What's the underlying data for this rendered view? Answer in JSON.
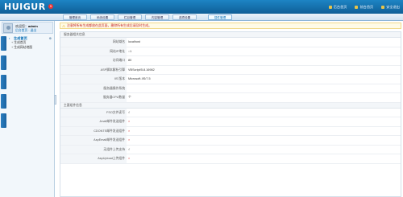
{
  "header": {
    "logo": "HUIGUR",
    "logo_badge": "5",
    "links": [
      {
        "label": "后台首页",
        "icon": "home-icon"
      },
      {
        "label": "前台首页",
        "icon": "globe-icon"
      },
      {
        "label": "安全退出",
        "icon": "logout-icon"
      }
    ]
  },
  "nav": {
    "tabs": [
      {
        "label": "管理首页"
      },
      {
        "label": "系统设置"
      },
      {
        "label": "栏目管理"
      },
      {
        "label": "内容管理"
      },
      {
        "label": "选项设置"
      },
      {
        "label": "插件管理"
      }
    ],
    "active_index": 5
  },
  "sidebar": {
    "welcome_prefix": "欢迎您：",
    "username": "admin",
    "user_links": "后台首页 · 退出",
    "menu_title": "生成首页",
    "menu_items": [
      {
        "label": "生成首页"
      },
      {
        "label": "生成网站地图"
      }
    ]
  },
  "notice": {
    "text": "注意将所有生成都放在此页面，删除所有生成后请及时生成。"
  },
  "section1": {
    "title": "服务器相关信息",
    "rows": [
      {
        "label": "网站域名",
        "value": "localhost",
        "status": "normal"
      },
      {
        "label": "网站IP地址",
        "value": "::1",
        "status": "normal"
      },
      {
        "label": "访问端口",
        "value": "80",
        "status": "normal"
      },
      {
        "label": "ASP脚本解析引擎",
        "value": "VBScript/5.8.16982",
        "status": "normal"
      },
      {
        "label": "IIS 版本",
        "value": "Microsoft-IIS/7.5",
        "status": "normal"
      },
      {
        "label": "服务器操作系统",
        "value": "",
        "status": "normal"
      },
      {
        "label": "服务器CPU数量",
        "value": "个",
        "status": "normal"
      }
    ]
  },
  "section2": {
    "title": "主要组件信息",
    "rows": [
      {
        "label": "FSO文件读写",
        "value": "√",
        "status": "good"
      },
      {
        "label": "Jmail邮件发送组件",
        "value": "×",
        "status": "bad"
      },
      {
        "label": "CDONTS邮件发送组件",
        "value": "×",
        "status": "bad"
      },
      {
        "label": "AspEmail邮件发送组件",
        "value": "×",
        "status": "bad"
      },
      {
        "label": "无组件上传支持",
        "value": "√",
        "status": "good"
      },
      {
        "label": "AspUpload上传组件",
        "value": "×",
        "status": "bad"
      }
    ]
  },
  "colors": {
    "header": "#1478b8",
    "error": "#d32f2f",
    "link": "#0b6fb5"
  }
}
